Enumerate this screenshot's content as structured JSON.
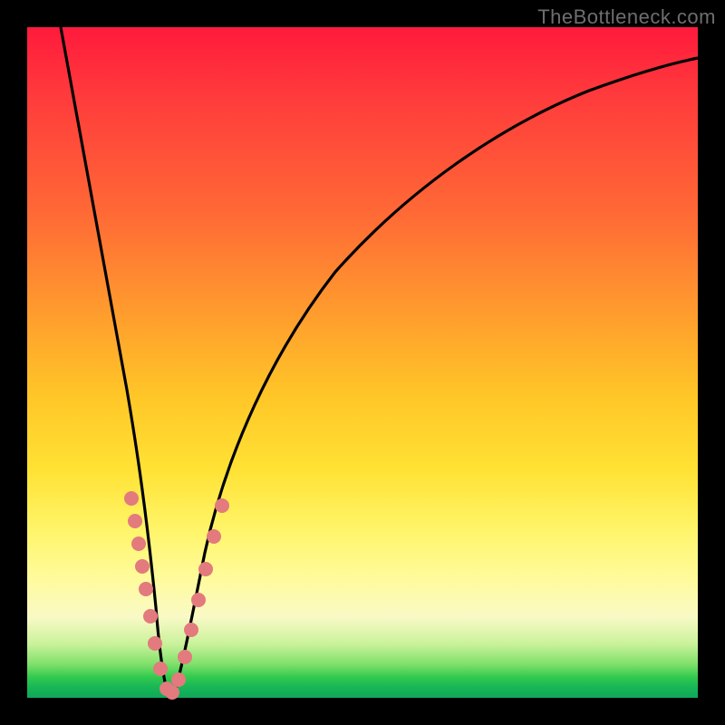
{
  "watermark": "TheBottleneck.com",
  "colors": {
    "frame": "#000000",
    "gradient_top": "#ff1a3c",
    "gradient_mid": "#ffe234",
    "gradient_bottom": "#0fa85a",
    "curve": "#000000",
    "beads": "#e37a7d"
  },
  "chart_data": {
    "type": "line",
    "title": "",
    "xlabel": "",
    "ylabel": "",
    "xlim": [
      0,
      100
    ],
    "ylim": [
      0,
      100
    ],
    "annotations": [
      "V-shaped bottleneck curve with minimum near x≈20; colored dots cluster on both arms near the trough"
    ],
    "series": [
      {
        "name": "bottleneck-curve",
        "x": [
          5,
          8,
          10,
          12,
          14,
          16,
          18,
          19,
          20,
          21,
          22,
          24,
          28,
          35,
          45,
          55,
          65,
          75,
          85,
          95,
          100
        ],
        "y": [
          100,
          78,
          62,
          48,
          36,
          22,
          10,
          4,
          1,
          3,
          8,
          16,
          28,
          44,
          58,
          68,
          76,
          82,
          87,
          91,
          93
        ]
      },
      {
        "name": "marker-dots",
        "x": [
          15.0,
          15.6,
          16.4,
          17.2,
          18.0,
          18.8,
          19.5,
          20.0,
          20.6,
          21.4,
          22.2,
          23.0,
          23.8,
          24.6,
          25.4,
          26.2,
          27.0
        ],
        "y": [
          28,
          24,
          20,
          16,
          11,
          7,
          4,
          1.5,
          3,
          6,
          10,
          14,
          18,
          22,
          25,
          29,
          32
        ]
      }
    ]
  }
}
